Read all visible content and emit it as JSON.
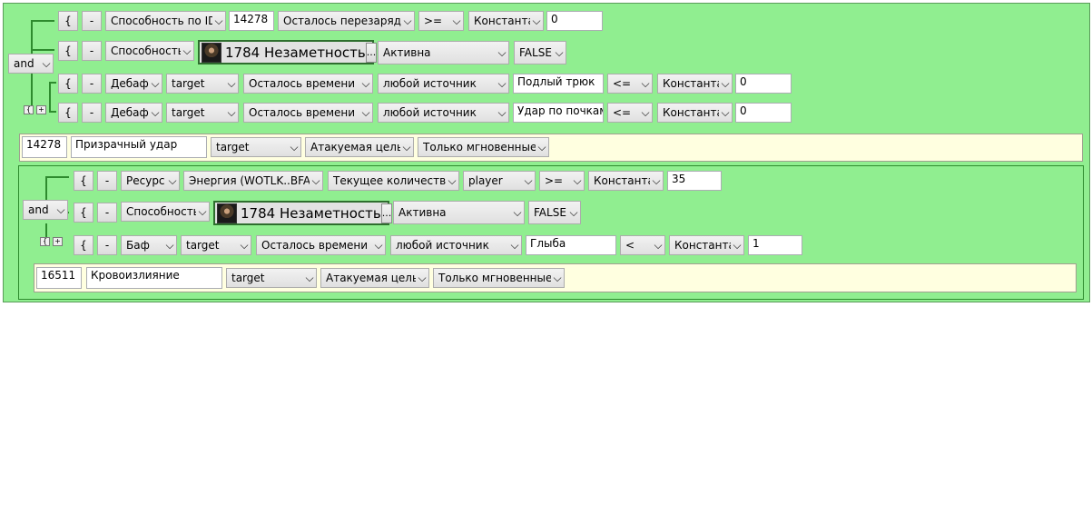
{
  "glyphs": {
    "open_brace": "{",
    "remove": "-",
    "ellipsis": "...",
    "chevron": "⌵",
    "mini_brace": "{",
    "mini_plus": "+"
  },
  "block1": {
    "logic": "and",
    "rows": [
      {
        "type": "Способность по ID",
        "id": "14278",
        "param": "Осталось перезарядки",
        "op": ">=",
        "cmp": "Константа",
        "val": "0"
      },
      {
        "type": "Способность",
        "spell_id": "1784",
        "spell_name": "Незаметность",
        "state": "Активна",
        "bool": "FALSE"
      },
      {
        "type": "Дебаф",
        "target": "target",
        "param": "Осталось времени",
        "source": "любой источник",
        "name": "Подлый трюк",
        "op": "<=",
        "cmp": "Константа",
        "val": "0"
      },
      {
        "type": "Дебаф",
        "target": "target",
        "param": "Осталось времени",
        "source": "любой источник",
        "name": "Удар по почкам",
        "op": "<=",
        "cmp": "Константа",
        "val": "0"
      }
    ],
    "action": {
      "id": "14278",
      "name": "Призрачный удар",
      "target": "target",
      "mode": "Атакуемая цель",
      "cast": "Только мгновенные"
    }
  },
  "block2": {
    "logic": "and",
    "rows": [
      {
        "type": "Ресурс",
        "resource": "Энергия (WOTLK..BFA)",
        "param": "Текущее количество",
        "unit": "player",
        "op": ">=",
        "cmp": "Константа",
        "val": "35"
      },
      {
        "type": "Способность",
        "spell_id": "1784",
        "spell_name": "Незаметность",
        "state": "Активна",
        "bool": "FALSE"
      },
      {
        "type": "Баф",
        "target": "target",
        "param": "Осталось времени",
        "source": "любой источник",
        "name": "Глыба",
        "op": "<",
        "cmp": "Константа",
        "val": "1"
      }
    ],
    "action": {
      "id": "16511",
      "name": "Кровоизлияние",
      "target": "target",
      "mode": "Атакуемая цель",
      "cast": "Только мгновенные"
    }
  },
  "colors": {
    "panel": "#90ee90",
    "border": "#2e8b2e",
    "action_bg": "#ffffe0"
  }
}
